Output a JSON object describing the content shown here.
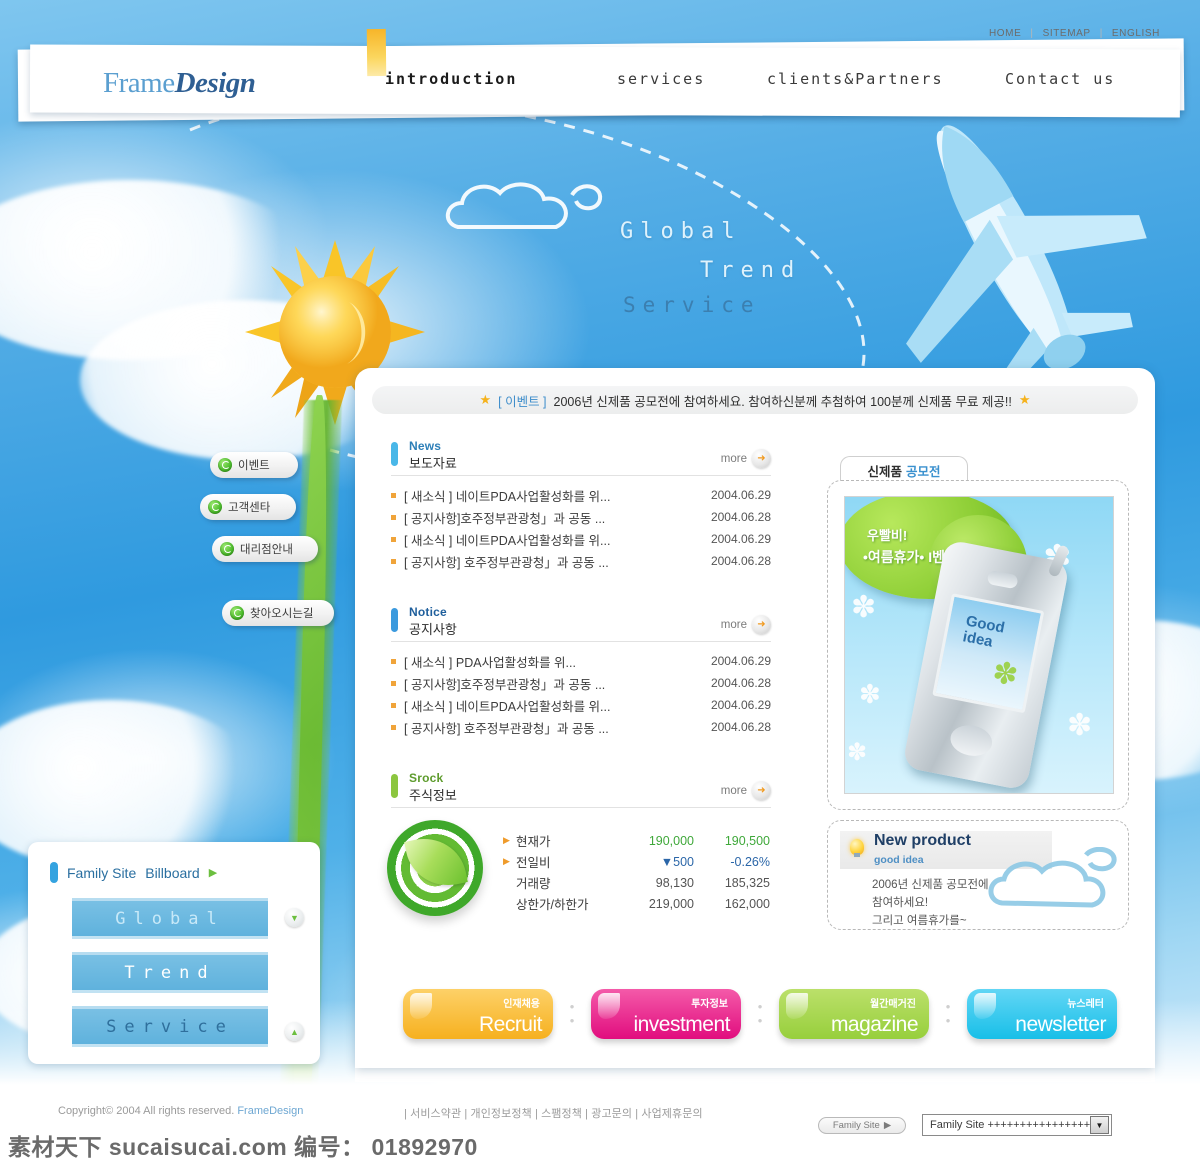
{
  "site": {
    "logo_frame": "Frame",
    "logo_design": "Design"
  },
  "toplinks": [
    {
      "label": "HOME"
    },
    {
      "label": "SITEMAP"
    },
    {
      "label": "ENGLISH"
    }
  ],
  "nav": [
    {
      "label": "introduction",
      "active": true
    },
    {
      "label": "services",
      "active": false
    },
    {
      "label": "clients&Partners",
      "active": false
    },
    {
      "label": "Contact us",
      "active": false
    }
  ],
  "hero": {
    "line1": "Global",
    "line2": "Trend",
    "line3": "Service"
  },
  "side_menu": [
    {
      "label": "이벤트"
    },
    {
      "label": "고객센타"
    },
    {
      "label": "대리점안내"
    },
    {
      "label": "찾아오시는길"
    }
  ],
  "event_bar": {
    "tag": "[ 이벤트 ]",
    "text": "2006년 신제품 공모전에 참여하세요. 참여하신분께 추첨하여 100분께 신제품 무료 제공!!"
  },
  "sections": [
    {
      "en": "News",
      "ko": "보도자료",
      "more": "more",
      "accent": "#49b7e8",
      "en_color": "#2d7fb8",
      "items": [
        {
          "title": "[ 새소식 ] 네이트PDA사업활성화를 위...",
          "date": "2004.06.29"
        },
        {
          "title": "[ 공지사항]호주정부관광청」과 공동 ...",
          "date": "2004.06.28"
        },
        {
          "title": "[ 새소식 ] 네이트PDA사업활성화를 위...",
          "date": "2004.06.29"
        },
        {
          "title": "[ 공지사항] 호주정부관광청」과 공동 ...",
          "date": "2004.06.28"
        }
      ]
    },
    {
      "en": "Notice",
      "ko": "공지사항",
      "more": "more",
      "accent": "#3b9ade",
      "en_color": "#1f5f9c",
      "items": [
        {
          "title": "[ 새소식 ] PDA사업활성화를 위...",
          "date": "2004.06.29"
        },
        {
          "title": "[ 공지사항]호주정부관광청」과 공동 ...",
          "date": "2004.06.28"
        },
        {
          "title": "[ 새소식 ] 네이트PDA사업활성화를 위...",
          "date": "2004.06.29"
        },
        {
          "title": "[ 공지사항] 호주정부관광청」과 공동 ...",
          "date": "2004.06.28"
        }
      ]
    }
  ],
  "stock": {
    "en": "Srock",
    "ko": "주식정보",
    "more": "more",
    "accent": "#8cc63f",
    "en_color": "#5d9b2c",
    "rows": [
      {
        "label": "현재가",
        "v1": "190,000",
        "v2": "190,500",
        "style": "grn",
        "arrow": true
      },
      {
        "label": "전일비",
        "v1": "▼500",
        "v2": "-0.26%",
        "style": "blu",
        "arrow": true
      },
      {
        "label": "거래량",
        "v1": "98,130",
        "v2": "185,325",
        "style": "gry",
        "arrow": false
      },
      {
        "label": "상한가/하한가",
        "v1": "219,000",
        "v2": "162,000",
        "style": "gry",
        "arrow": false
      }
    ]
  },
  "promo": {
    "tab_bold": "신제품",
    "tab_blue": "공모전",
    "blob_line1": "우빨비!",
    "blob_line2": "•여름휴가• I벤트",
    "phone_screen": "Good\nidea"
  },
  "new_product": {
    "title": "New product",
    "subtitle": "good idea",
    "body": "2006년 신제품 공모전에\n참여하세요!\n그리고 여름휴가를~"
  },
  "pills": [
    {
      "ko": "인재채용",
      "en": "Recruit",
      "c1": "#fdd168",
      "c2": "#f6b01f"
    },
    {
      "ko": "투자정보",
      "en": "investment",
      "c1": "#f45aa9",
      "c2": "#e10d7e"
    },
    {
      "ko": "월간매거진",
      "en": "magazine",
      "c1": "#bbe06a",
      "c2": "#97cf3c"
    },
    {
      "ko": "뉴스레터",
      "en": "newsletter",
      "c1": "#62d6f5",
      "c2": "#18bfe8"
    }
  ],
  "pill_separator": ":",
  "family_panel": {
    "title1": "Family Site",
    "title2": "Billboard",
    "boards": [
      {
        "label": "Global"
      },
      {
        "label": "Trend"
      },
      {
        "label": "Service"
      }
    ]
  },
  "footer": {
    "copyright": "Copyright© 2004 All rights reserved.",
    "brand": "FrameDesign",
    "links": "| 서비스약관 | 개인정보정책 | 스팸정책 | 광고문의 | 사업제휴문의",
    "family_pill": "Family Site",
    "select_value": "Family Site ++++++++++++++++"
  },
  "watermark": "素材天下 sucaisucai.com  编号： 01892970"
}
